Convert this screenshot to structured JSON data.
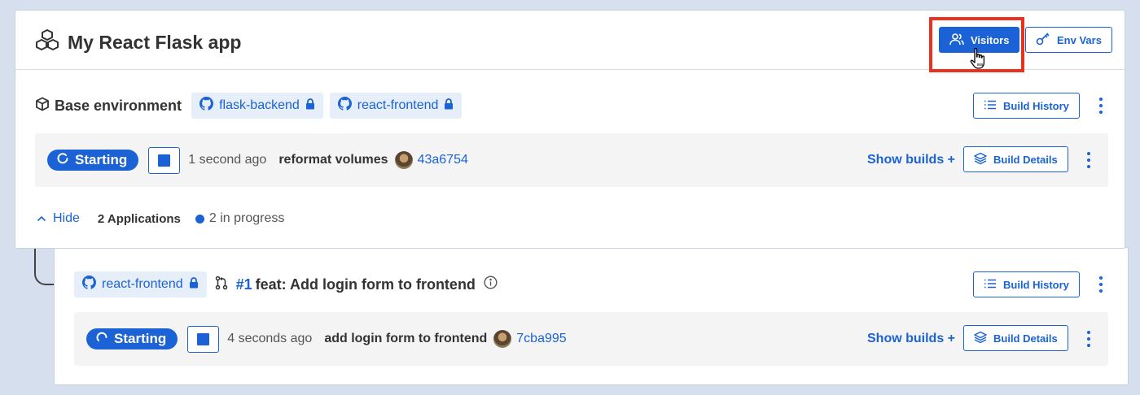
{
  "header": {
    "app_title": "My React Flask app",
    "title_icon": "cubes-icon",
    "visitors_label": "Visitors",
    "env_vars_label": "Env Vars"
  },
  "base_environment": {
    "label": "Base environment",
    "repos": [
      {
        "name": "flask-backend",
        "locked": true
      },
      {
        "name": "react-frontend",
        "locked": true
      }
    ],
    "build_history_label": "Build History",
    "status": {
      "state": "Starting",
      "time": "1 second ago",
      "commit_message": "reformat volumes",
      "commit_sha": "43a6754",
      "show_builds_label": "Show builds +",
      "build_details_label": "Build Details"
    }
  },
  "applications": {
    "hide_label": "Hide",
    "count_label": "2 Applications",
    "progress_label": "2 in progress"
  },
  "child": {
    "repo": "react-frontend",
    "pr_number": "#1",
    "pr_title": "feat: Add login form to frontend",
    "build_history_label": "Build History",
    "status": {
      "state": "Starting",
      "time": "4 seconds ago",
      "commit_message": "add login form to frontend",
      "commit_sha": "7cba995",
      "show_builds_label": "Show builds +",
      "build_details_label": "Build Details"
    }
  },
  "colors": {
    "accent": "#1a62d6",
    "highlight": "#e8321f",
    "background": "#d5dfed"
  }
}
